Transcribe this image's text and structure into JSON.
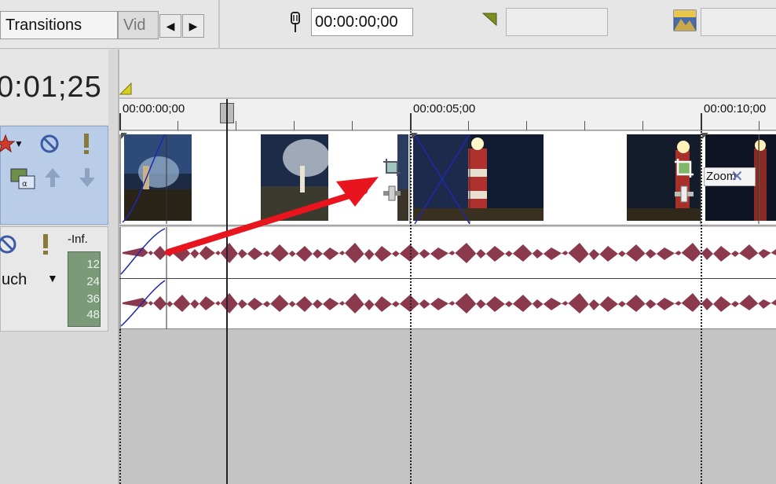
{
  "tabs": {
    "transitions": "Transitions",
    "video_fx_partial": "Vid",
    "prev": "◀",
    "next": "▶"
  },
  "toolbar": {
    "cursor_time": "00:00:00;00",
    "marker_icon": "marker-pin-icon",
    "region_icon": "region-flag-icon",
    "snapshot_icon": "snapshot-icon"
  },
  "timeline_header": {
    "cursor_position": "0:01;25"
  },
  "ruler": {
    "labels": [
      "00:00:00;00",
      "00:00:05;00",
      "00:00:10;00"
    ]
  },
  "video_track": {
    "icons": [
      "fx-star-icon",
      "mute-icon",
      "solo-icon",
      "compositing-icon",
      "move-up-icon",
      "move-down-icon"
    ],
    "event_label": "Zoom"
  },
  "audio_track": {
    "mode": "uch",
    "meter_label": "-Inf.",
    "meter_scale": [
      "12",
      "24",
      "36",
      "48"
    ],
    "icons": [
      "mute-icon",
      "solo-icon"
    ]
  },
  "colors": {
    "waveform": "#8b3a4e",
    "video_header": "#b9cde8",
    "annotation_arrow": "#e8141e",
    "envelope": "#2a2ab0"
  }
}
